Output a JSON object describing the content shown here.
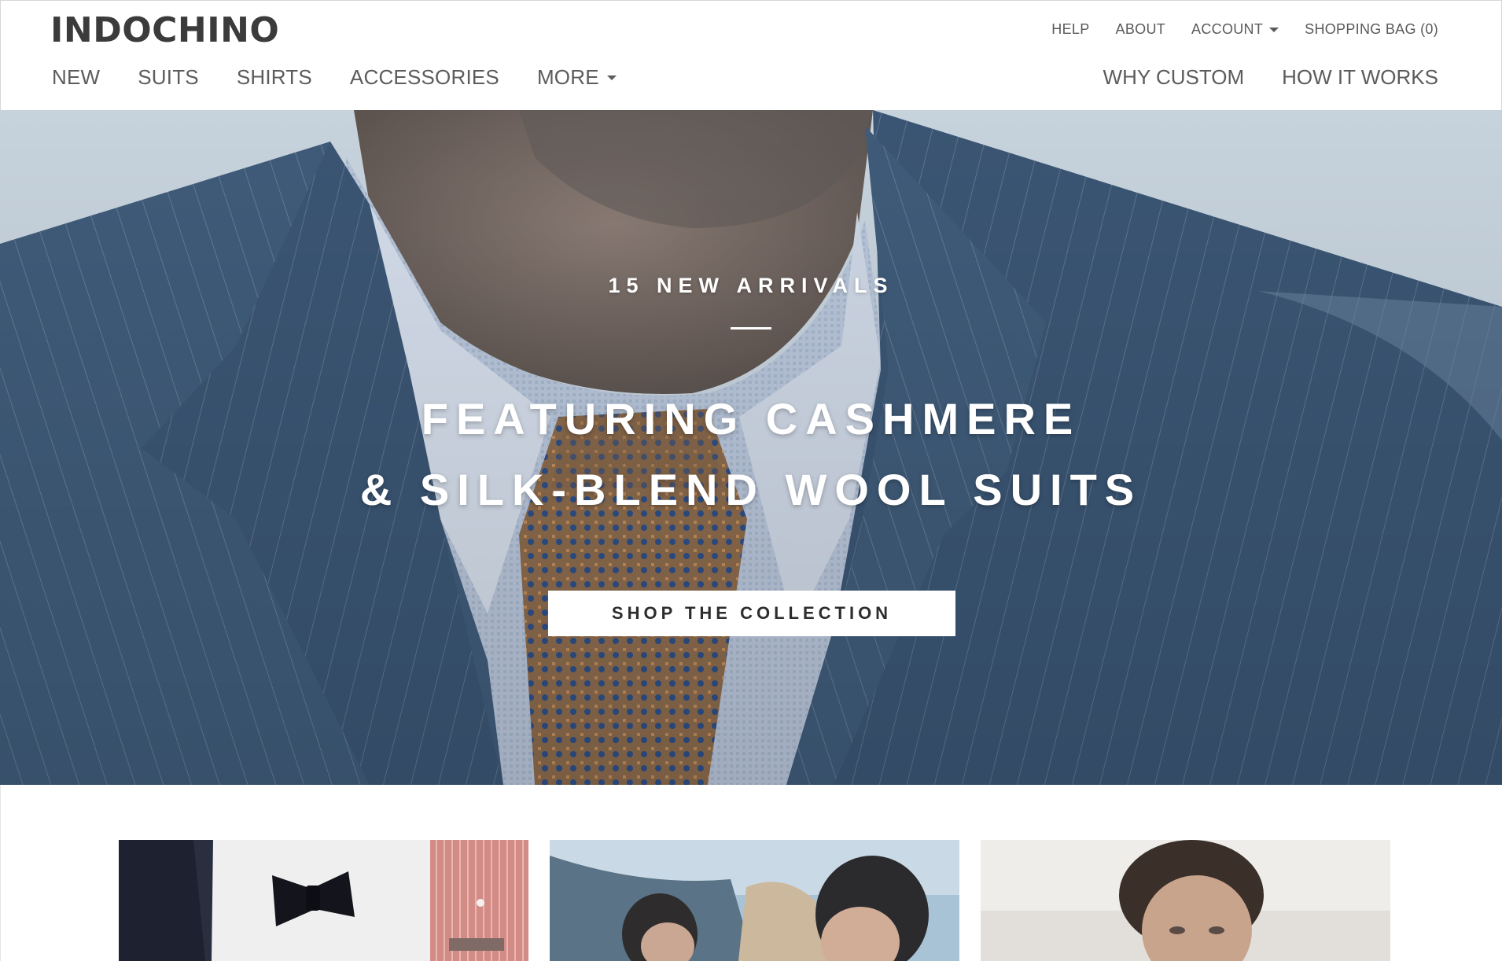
{
  "brand": {
    "logo_text": "INDOCHINO"
  },
  "utility_nav": {
    "help": "HELP",
    "about": "ABOUT",
    "account": "ACCOUNT",
    "shopping_bag": "SHOPPING BAG (0)"
  },
  "main_nav": {
    "items": [
      "NEW",
      "SUITS",
      "SHIRTS",
      "ACCESSORIES"
    ],
    "more": "MORE"
  },
  "secondary_nav": {
    "why_custom": "WHY CUSTOM",
    "how_it_works": "HOW IT WORKS"
  },
  "hero": {
    "eyebrow": "15 NEW ARRIVALS",
    "headline_line1": "FEATURING CASHMERE",
    "headline_line2": "& SILK-BLEND WOOL SUITS",
    "cta_label": "SHOP THE COLLECTION"
  },
  "colors": {
    "text": "#3e3e3e",
    "suit": "#3e5a78",
    "hero_overlay_text": "#ffffff",
    "cta_background": "#ffffff"
  },
  "icons": [
    "caret-down-icon"
  ]
}
